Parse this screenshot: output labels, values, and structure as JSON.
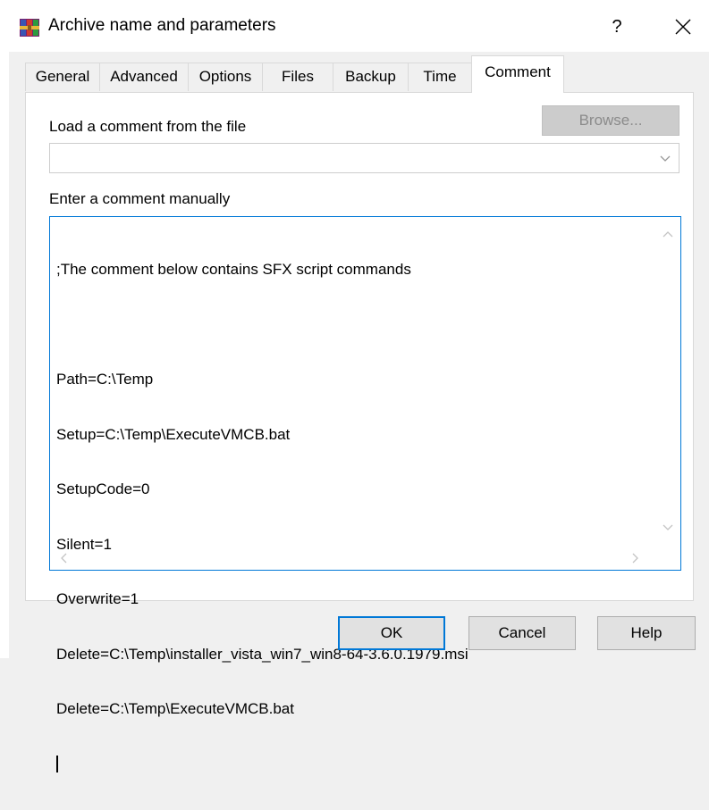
{
  "window": {
    "title": "Archive name and parameters",
    "help_symbol": "?"
  },
  "tabs": [
    {
      "label": "General",
      "active": false
    },
    {
      "label": "Advanced",
      "active": false
    },
    {
      "label": "Options",
      "active": false
    },
    {
      "label": "Files",
      "active": false
    },
    {
      "label": "Backup",
      "active": false
    },
    {
      "label": "Time",
      "active": false
    },
    {
      "label": "Comment",
      "active": true
    }
  ],
  "comment_tab": {
    "load_label": "Load a comment from the file",
    "browse_label": "Browse...",
    "file_value": "",
    "manual_label": "Enter a comment manually",
    "comment_lines": [
      ";The comment below contains SFX script commands",
      "",
      "Path=C:\\Temp",
      "Setup=C:\\Temp\\ExecuteVMCB.bat",
      "SetupCode=0",
      "Silent=1",
      "Overwrite=1",
      "Delete=C:\\Temp\\installer_vista_win7_win8-64-3.6.0.1979.msi",
      "Delete=C:\\Temp\\ExecuteVMCB.bat"
    ]
  },
  "buttons": {
    "ok": "OK",
    "cancel": "Cancel",
    "help": "Help"
  },
  "icons": {
    "app": "winrar-icon",
    "close": "close-icon"
  },
  "colors": {
    "focus_border": "#0078d7",
    "disabled_button": "#cccccc",
    "disabled_text": "#8b8b8b"
  }
}
